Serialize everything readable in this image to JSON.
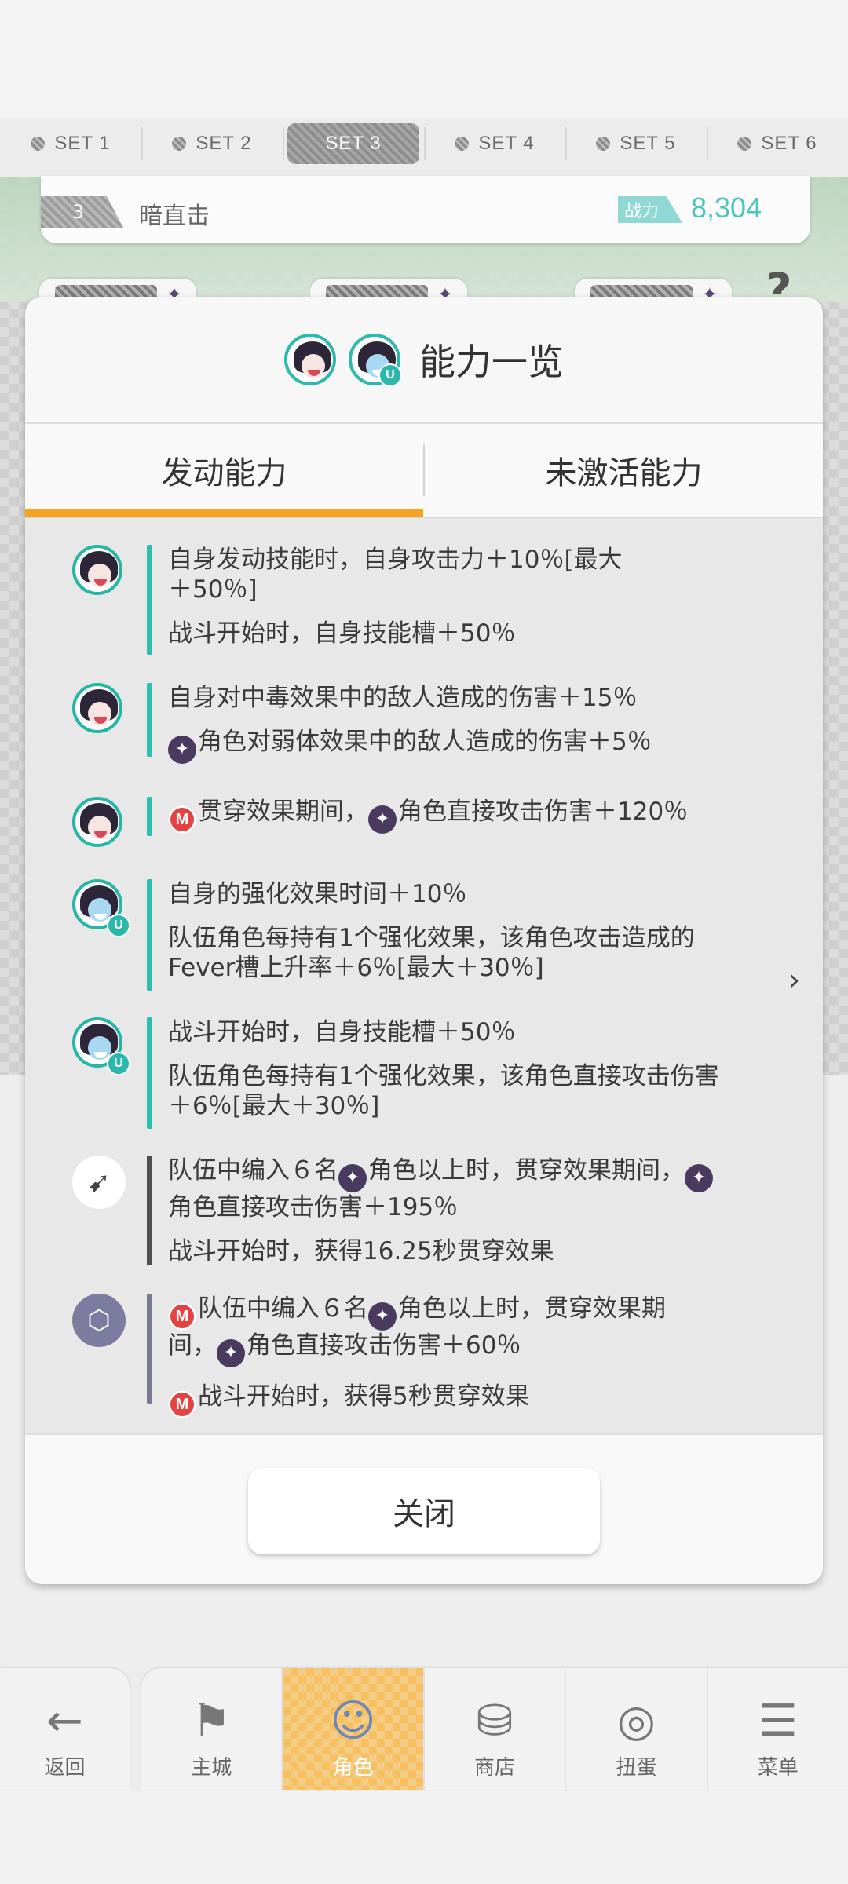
{
  "set_tabs": [
    {
      "label": "SET 1",
      "active": false
    },
    {
      "label": "SET 2",
      "active": false
    },
    {
      "label": "SET 3",
      "active": true
    },
    {
      "label": "SET 4",
      "active": false
    },
    {
      "label": "SET 5",
      "active": false
    },
    {
      "label": "SET 6",
      "active": false
    }
  ],
  "team": {
    "number": "3",
    "name": "暗直击",
    "power_label": "战力",
    "power_value": "8,304"
  },
  "modal": {
    "title": "能力一览",
    "tabs": [
      {
        "label": "发动能力",
        "active": true
      },
      {
        "label": "未激活能力",
        "active": false
      }
    ],
    "close_label": "关闭"
  },
  "abilities": [
    {
      "icon": "character-portrait-icon",
      "lines": [
        "自身发动技能时，自身攻击力＋10％[最大\n＋50％]",
        "战斗开始时，自身技能槽＋50％"
      ]
    },
    {
      "icon": "character-portrait-icon",
      "lines": [
        "自身对中毒效果中的敌人造成的伤害＋15％",
        "角色对弱体效果中的敌人造成的伤害＋5％"
      ]
    },
    {
      "icon": "character-portrait-icon",
      "lines": [
        "贯穿效果期间，",
        "角色直接攻击伤害＋120％"
      ]
    },
    {
      "icon": "character-portrait-u-icon",
      "lines": [
        "自身的强化效果时间＋10％",
        "队伍角色每持有1个强化效果，该角色攻击造成的\nFever槽上升率＋6％[最大＋30％]"
      ]
    },
    {
      "icon": "character-portrait-u-icon",
      "lines": [
        "战斗开始时，自身技能槽＋50％",
        "队伍角色每持有1个强化效果，该角色直接攻击伤害\n＋6％[最大＋30％]"
      ]
    },
    {
      "icon": "equipment-icon",
      "lines": [
        "队伍中编入６名",
        "角色以上时，贯穿效果期间，",
        "角色直接攻击伤害＋195％",
        "战斗开始时，获得16.25秒贯穿效果"
      ]
    },
    {
      "icon": "card-icon",
      "lines": [
        "队伍中编入６名",
        "角色以上时，贯穿效果期",
        "间，",
        "角色直接攻击伤害＋60％",
        "战斗开始时，获得5秒贯穿效果"
      ]
    }
  ],
  "bottom_nav": {
    "back_label": "返回",
    "items": [
      {
        "label": "主城",
        "icon": "castle-icon",
        "active": false
      },
      {
        "label": "角色",
        "icon": "character-icon",
        "active": true
      },
      {
        "label": "商店",
        "icon": "shop-icon",
        "active": false
      },
      {
        "label": "扭蛋",
        "icon": "gacha-icon",
        "active": false
      },
      {
        "label": "菜单",
        "icon": "menu-icon",
        "active": false
      }
    ]
  },
  "colors": {
    "accent_tab": "#f5a321",
    "teal_bar": "#2fbfae",
    "power_text": "#4dc4bd",
    "nav_active": "#f7bf5d"
  }
}
